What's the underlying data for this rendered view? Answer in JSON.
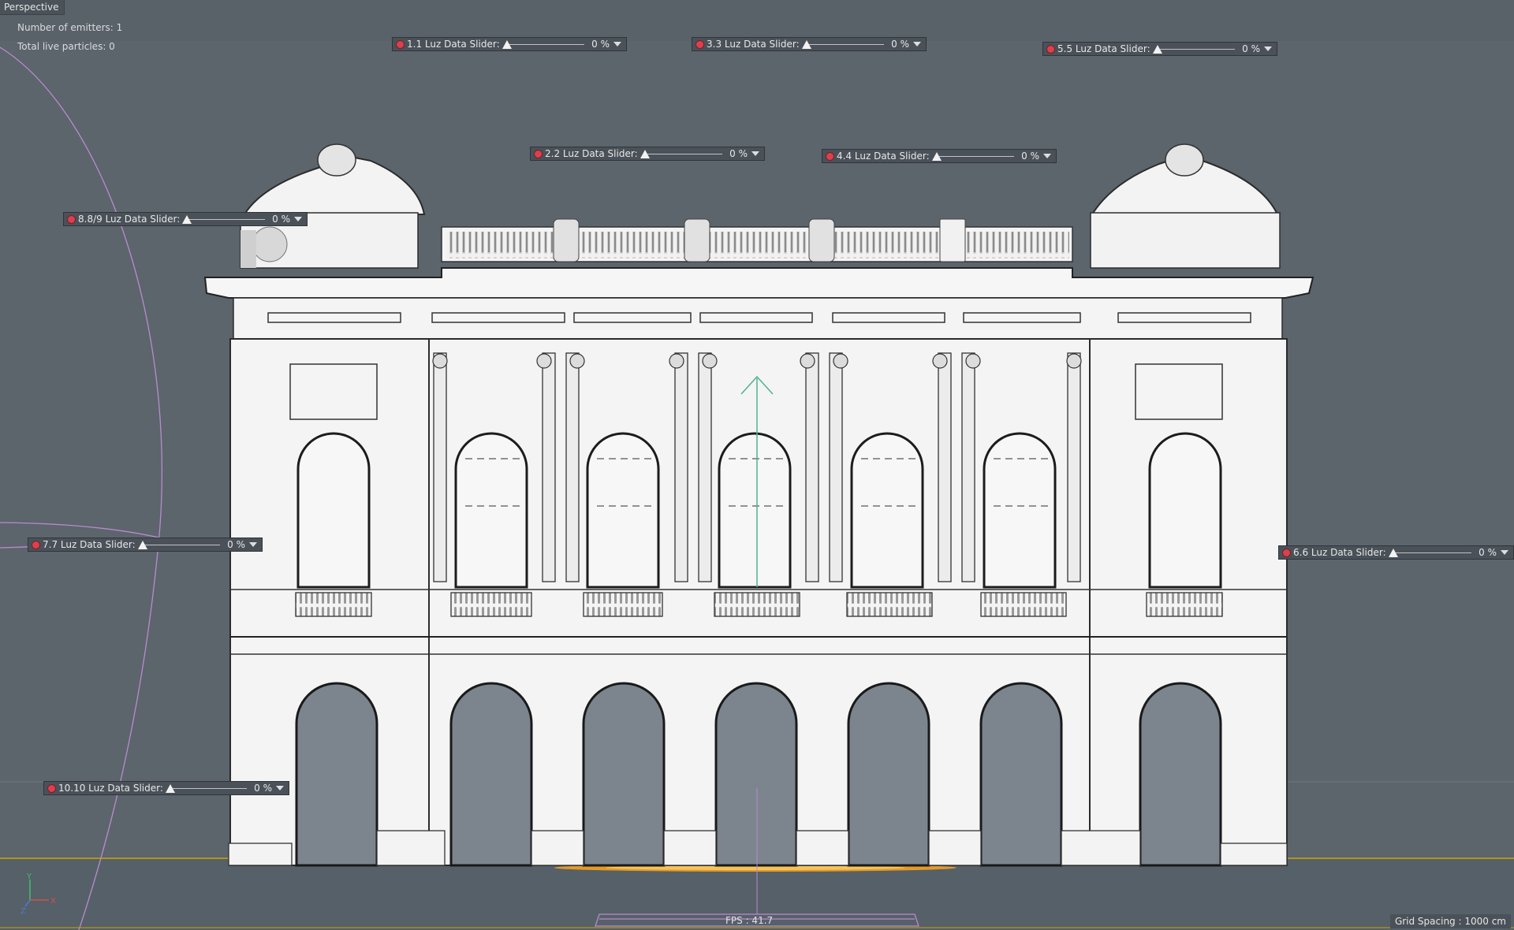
{
  "viewport": {
    "label": "Perspective",
    "hud": {
      "emitters": "Number of emitters: 1",
      "particles": "Total live particles: 0"
    },
    "fps": "FPS : 41.7",
    "grid_spacing": "Grid Spacing : 1000 cm"
  },
  "sliders": [
    {
      "label": "1.1 Luz Data Slider:",
      "value": "0 %",
      "level": 0
    },
    {
      "label": "3.3 Luz Data Slider:",
      "value": "0 %",
      "level": 0
    },
    {
      "label": "5.5 Luz Data Slider:",
      "value": "0 %",
      "level": 0
    },
    {
      "label": "2.2 Luz Data Slider:",
      "value": "0 %",
      "level": 0
    },
    {
      "label": "4.4 Luz Data Slider:",
      "value": "0 %",
      "level": 0
    },
    {
      "label": "8.8/9 Luz Data Slider:",
      "value": "0 %",
      "level": 0
    },
    {
      "label": "7.7 Luz Data Slider:",
      "value": "0 %",
      "level": 0
    },
    {
      "label": "6.6 Luz Data Slider:",
      "value": "0 %",
      "level": 0
    },
    {
      "label": "10.10 Luz Data Slider:",
      "value": "0 %",
      "level": 0
    }
  ],
  "colors": {
    "background": "#5c646c",
    "model": "#f4f4f4",
    "slider_dot": "#d9414e",
    "spline": "#b98ad0",
    "ground_line": "#c9a500"
  }
}
